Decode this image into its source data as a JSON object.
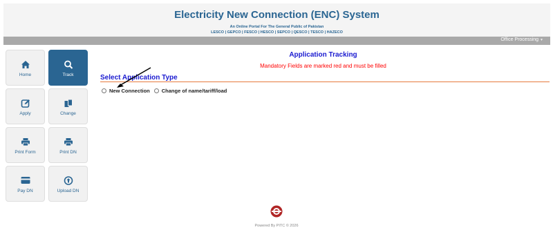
{
  "header": {
    "title": "Electricity New Connection (ENC) System",
    "subtitle": "An Online Portal For The General Public of Pakistan",
    "companies": "LESCO | GEPCO | FESCO | HESCO | SEPCO | QESCO | TESCO | HAZECO"
  },
  "topbar": {
    "office": "Office Processing"
  },
  "sidebar": {
    "items": [
      {
        "label": "Home",
        "icon": "home-icon"
      },
      {
        "label": "Track",
        "icon": "search-icon",
        "active": true
      },
      {
        "label": "Apply",
        "icon": "edit-icon"
      },
      {
        "label": "Change",
        "icon": "copy-icon"
      },
      {
        "label": "Print Form",
        "icon": "print-icon"
      },
      {
        "label": "Print DN",
        "icon": "print-icon"
      },
      {
        "label": "Pay DN",
        "icon": "credit-card-icon"
      },
      {
        "label": "Upload DN",
        "icon": "upload-icon"
      }
    ]
  },
  "main": {
    "heading": "Application Tracking",
    "notice": "Mandatory Fields are marked red and must be filled",
    "section_title": "Select Application Type",
    "options": [
      "New Connection",
      "Change of name/tariff/load"
    ]
  },
  "footer": {
    "powered_by": "Powered By PITC © 2026"
  },
  "colors": {
    "brand": "#2a6592",
    "heading": "#1a1ad0",
    "required": "#ff0000",
    "rule": "#e67a3c"
  }
}
